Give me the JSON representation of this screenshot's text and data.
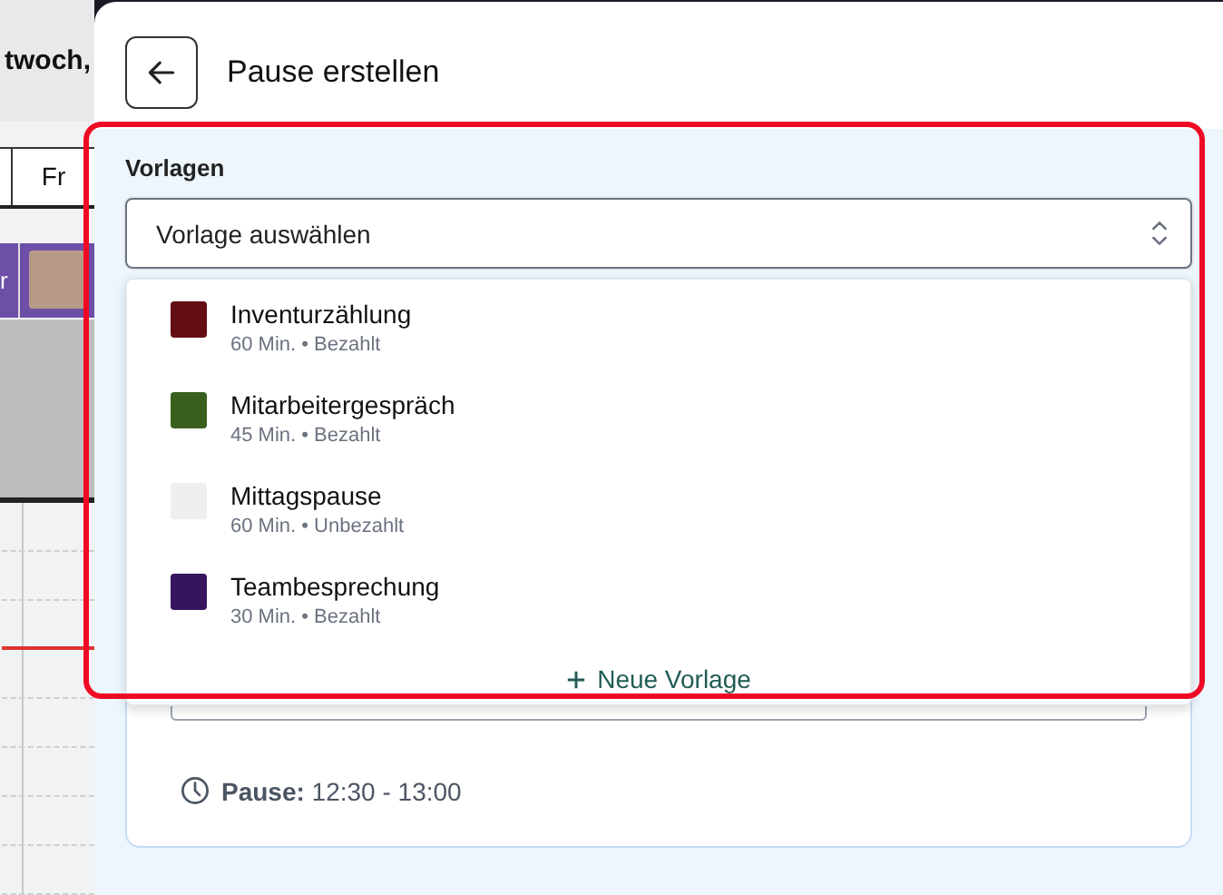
{
  "calendar_background": {
    "header_text": "twoch,",
    "day_label": "Fr",
    "staff_label": "r"
  },
  "panel": {
    "title": "Pause erstellen"
  },
  "template_field": {
    "label": "Vorlagen",
    "placeholder": "Vorlage auswählen",
    "expanded": true
  },
  "templates": [
    {
      "name": "Inventurzählung",
      "details": "60 Min. • Bezahlt",
      "color": "#640d14"
    },
    {
      "name": "Mitarbeitergespräch",
      "details": "45 Min. • Bezahlt",
      "color": "#38601c"
    },
    {
      "name": "Mittagspause",
      "details": "60 Min. • Unbezahlt",
      "color": "#efefef"
    },
    {
      "name": "Teambesprechung",
      "details": "30 Min. • Bezahlt",
      "color": "#35155d"
    }
  ],
  "new_template": "Neue Vorlage",
  "summary": {
    "text": "**Pause:** 12:30 - 13:00"
  }
}
